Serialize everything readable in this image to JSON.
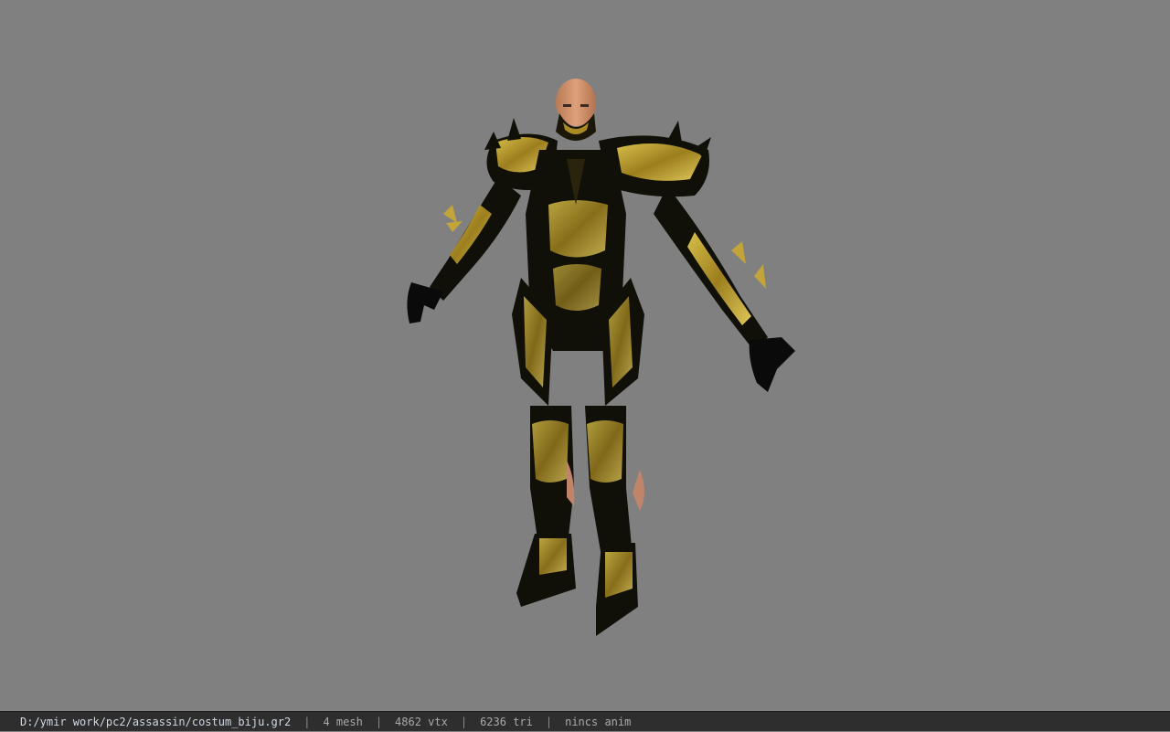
{
  "viewport": {
    "background_color": "#808080",
    "model": {
      "description": "armored-character",
      "gold": "#b89a2a",
      "dark": "#111008",
      "skin": "#c98a63"
    }
  },
  "statusbar": {
    "file_path": "D:/ymir work/pc2/assassin/costum_biju.gr2",
    "separator": "|",
    "mesh_count": "4 mesh",
    "vertex_count": "4862 vtx",
    "triangle_count": "6236 tri",
    "anim_status": "nincs anim"
  }
}
